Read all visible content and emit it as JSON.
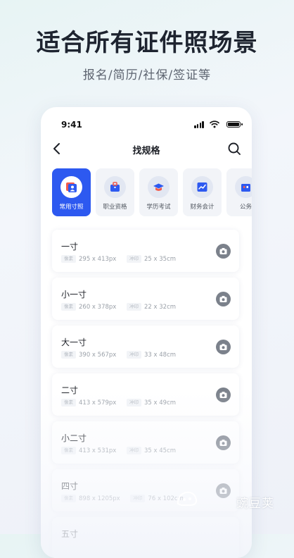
{
  "hero": {
    "title": "适合所有证件照场景",
    "subtitle": "报名/简历/社保/签证等"
  },
  "status_bar": {
    "time": "9:41"
  },
  "nav": {
    "title": "找规格"
  },
  "categories": [
    {
      "label": "常用寸照",
      "icon": "portrait-icon",
      "active": true
    },
    {
      "label": "职业资格",
      "icon": "briefcase-icon",
      "active": false
    },
    {
      "label": "学历考试",
      "icon": "graduation-cap-icon",
      "active": false
    },
    {
      "label": "财务会计",
      "icon": "chart-icon",
      "active": false
    },
    {
      "label": "公务",
      "icon": "building-icon",
      "active": false
    }
  ],
  "tags": {
    "pixel": "像素",
    "print": "冲印"
  },
  "specs": [
    {
      "name": "一寸",
      "pixels": "295 x 413px",
      "print": "25 x 35cm"
    },
    {
      "name": "小一寸",
      "pixels": "260 x 378px",
      "print": "22 x 32cm"
    },
    {
      "name": "大一寸",
      "pixels": "390 x 567px",
      "print": "33 x 48cm"
    },
    {
      "name": "二寸",
      "pixels": "413 x 579px",
      "print": "35 x 49cm"
    },
    {
      "name": "小二寸",
      "pixels": "413 x 531px",
      "print": "35 x 45cm"
    },
    {
      "name": "四寸",
      "pixels": "898 x 1205px",
      "print": "76 x 102cm"
    },
    {
      "name": "五寸",
      "pixels": "",
      "print": ""
    }
  ],
  "watermark": {
    "text": "豌豆荚"
  },
  "colors": {
    "accent": "#2d59f0",
    "camera": "#7b818b"
  }
}
